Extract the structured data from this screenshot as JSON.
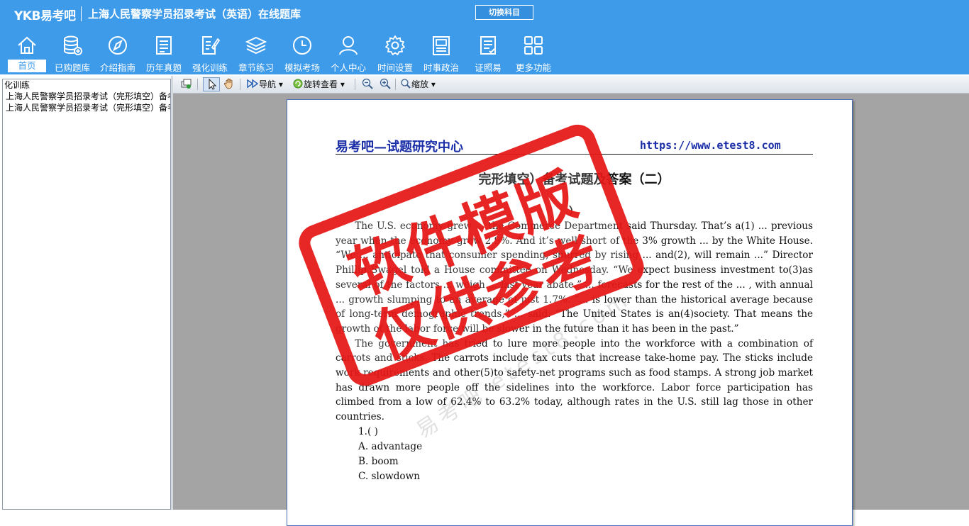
{
  "app": {
    "logo": "YKB易考吧",
    "title": "上海人民警察学员招录考试（英语）在线题库",
    "switch_label": "切换科目"
  },
  "nav": [
    {
      "label": "首页",
      "icon": "home-icon",
      "active": true
    },
    {
      "label": "已购题库",
      "icon": "database-icon"
    },
    {
      "label": "介绍指南",
      "icon": "compass-icon"
    },
    {
      "label": "历年真题",
      "icon": "document-list-icon"
    },
    {
      "label": "强化训练",
      "icon": "edit-document-icon"
    },
    {
      "label": "章节练习",
      "icon": "layers-icon"
    },
    {
      "label": "模拟考场",
      "icon": "clock-icon"
    },
    {
      "label": "个人中心",
      "icon": "user-icon"
    },
    {
      "label": "时间设置",
      "icon": "gear-icon"
    },
    {
      "label": "时事政治",
      "icon": "newspaper-icon"
    },
    {
      "label": "证照易",
      "icon": "certificate-icon"
    },
    {
      "label": "更多功能",
      "icon": "grid-icon"
    }
  ],
  "sidebar": {
    "items": [
      "化训练",
      "上海人民警察学员招录考试（完形填空）备考试题及答案",
      "上海人民警察学员招录考试（完形填空）备考试题及答案"
    ]
  },
  "toolbar": {
    "nav_label": "导航",
    "rotate_label": "旋转查看",
    "zoom_label": "缩放"
  },
  "document": {
    "header_left": "易考吧—试题研究中心",
    "header_right": "https://www.etest8.com",
    "title": "完形填空）备考试题及答案（二）",
    "subheading": "）",
    "paragraphs": [
      "The U.S. economy grew ... the Commerce Department said Thursday. That’s a(1) ... previous year when the economy grew 2.9%. And it’s well short of the 3% growth ... by the White House. “We ... anticipate that consumer spending, spurred by rising ... and(2), will remain ...” Director Phillip Swagel told a House committee on Wednesday. “We expect business investment to(3)as several of the factors ... weigh ... last year abate.” ... forecasts for the rest of the ... , with annual ... growth slumping to an average of just 1.7%. “... is lower than the historical average because of long-term demographic trends,” ... said. “The United States is an(4)society. That means the growth of the labor force will be slower in the future than it has been in the past.”",
      "The government has tried to lure more people into the workforce with a combination of carrots and sticks. The carrots include tax cuts that increase take-home pay. The sticks include work requirements and other(5)to safety-net programs such as food stamps. A strong job market has drawn more people off the sidelines into the workforce. Labor force participation has climbed from a low of 62.4% to 63.2% today, although rates in the U.S. still lag those in other countries."
    ],
    "questions": [
      "1.(   )",
      "A. advantage",
      "B. boom",
      "C. slowdown"
    ]
  },
  "watermark": {
    "stamp_line1": "软件模版",
    "stamp_line2": "仅供参考",
    "faint": "易考吧 etest8.com"
  }
}
